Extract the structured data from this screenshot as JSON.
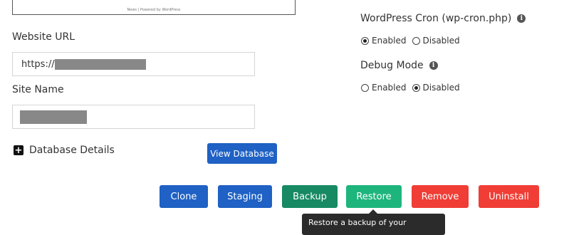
{
  "preview": {
    "footer_text": "News | Powered by WordPress"
  },
  "website_url": {
    "label": "Website URL",
    "prefix": "https://"
  },
  "site_name": {
    "label": "Site Name"
  },
  "database": {
    "toggle_label": "Database Details",
    "toggle_icon": "plus-square-icon",
    "view_button": "View Database"
  },
  "wp_cron": {
    "label": "WordPress Cron (wp-cron.php)",
    "options": [
      "Enabled",
      "Disabled"
    ],
    "selected": "Enabled"
  },
  "debug_mode": {
    "label": "Debug Mode",
    "options": [
      "Enabled",
      "Disabled"
    ],
    "selected": "Disabled"
  },
  "info_icon_glyph": "i",
  "actions": {
    "clone": "Clone",
    "staging": "Staging",
    "backup": "Backup",
    "restore": "Restore",
    "remove": "Remove",
    "uninstall": "Uninstall"
  },
  "tooltip": {
    "text": "Restore a backup of your"
  },
  "colors": {
    "blue": "#1f61c4",
    "dark_green": "#178a63",
    "green": "#1eb57d",
    "red": "#f03d36",
    "tooltip_bg": "#2b2b2b"
  }
}
